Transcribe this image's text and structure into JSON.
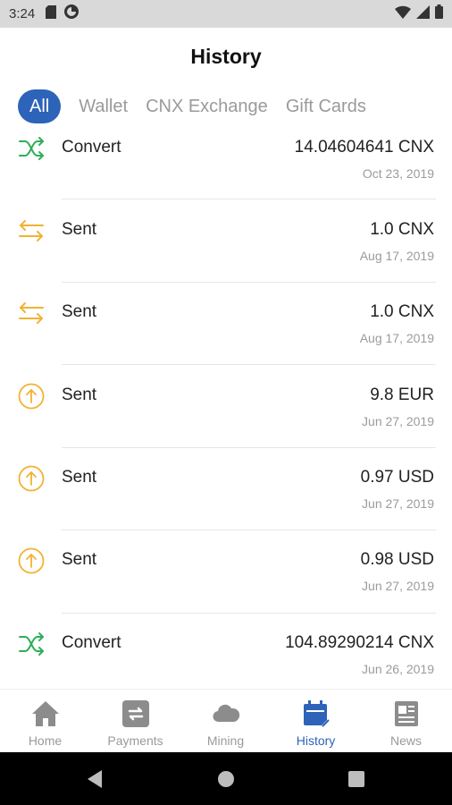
{
  "status_bar": {
    "time": "3:24"
  },
  "header": {
    "title": "History"
  },
  "tabs": [
    {
      "label": "All",
      "active": true
    },
    {
      "label": "Wallet",
      "active": false
    },
    {
      "label": "CNX Exchange",
      "active": false
    },
    {
      "label": "Gift Cards",
      "active": false
    }
  ],
  "transactions": [
    {
      "type": "Convert",
      "icon": "convert-icon",
      "amount": "14.04604641 CNX",
      "date": "Oct 23, 2019"
    },
    {
      "type": "Sent",
      "icon": "transfer-arrows-icon",
      "amount": "1.0 CNX",
      "date": "Aug 17, 2019"
    },
    {
      "type": "Sent",
      "icon": "transfer-arrows-icon",
      "amount": "1.0 CNX",
      "date": "Aug 17, 2019"
    },
    {
      "type": "Sent",
      "icon": "arrow-up-circle-icon",
      "amount": "9.8 EUR",
      "date": "Jun 27, 2019"
    },
    {
      "type": "Sent",
      "icon": "arrow-up-circle-icon",
      "amount": "0.97 USD",
      "date": "Jun 27, 2019"
    },
    {
      "type": "Sent",
      "icon": "arrow-up-circle-icon",
      "amount": "0.98 USD",
      "date": "Jun 27, 2019"
    },
    {
      "type": "Convert",
      "icon": "convert-icon",
      "amount": "104.89290214 CNX",
      "date": "Jun 26, 2019"
    }
  ],
  "bottom_nav": [
    {
      "label": "Home",
      "icon": "home-icon",
      "active": false
    },
    {
      "label": "Payments",
      "icon": "payments-icon",
      "active": false
    },
    {
      "label": "Mining",
      "icon": "cloud-icon",
      "active": false
    },
    {
      "label": "History",
      "icon": "calendar-icon",
      "active": true
    },
    {
      "label": "News",
      "icon": "news-icon",
      "active": false
    }
  ],
  "colors": {
    "accent": "#2d63b9",
    "convert_green": "#2eae5a",
    "sent_orange": "#f2b233",
    "nav_gray": "#9a9a9a"
  }
}
